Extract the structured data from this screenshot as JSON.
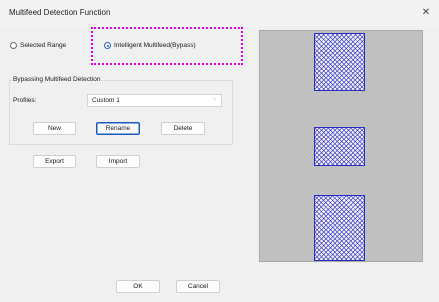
{
  "window": {
    "title": "Multifeed Detection Function",
    "close_glyph": "✕"
  },
  "mode": {
    "options": [
      {
        "label": "Selected Range",
        "checked": false
      },
      {
        "label": "Intelligent Multifeed(Bypass)",
        "checked": true
      }
    ]
  },
  "bypass_group": {
    "title": "Bypassing Multifeed Detection",
    "profiles_label": "Profiles:",
    "profile_value": "Custom 1",
    "buttons": {
      "new": "New",
      "rename": "Rename",
      "delete": "Delete"
    }
  },
  "actions": {
    "export": "Export",
    "import": "Import",
    "ok": "OK",
    "cancel": "Cancel"
  },
  "colors": {
    "highlight": "#e800e8",
    "preview_bg": "#c0c0c0",
    "document_pattern": "#2b2bc8",
    "accent": "#1a5ac0"
  },
  "icons": {
    "close": "close-icon",
    "dropdown": "chevron-down-icon"
  }
}
